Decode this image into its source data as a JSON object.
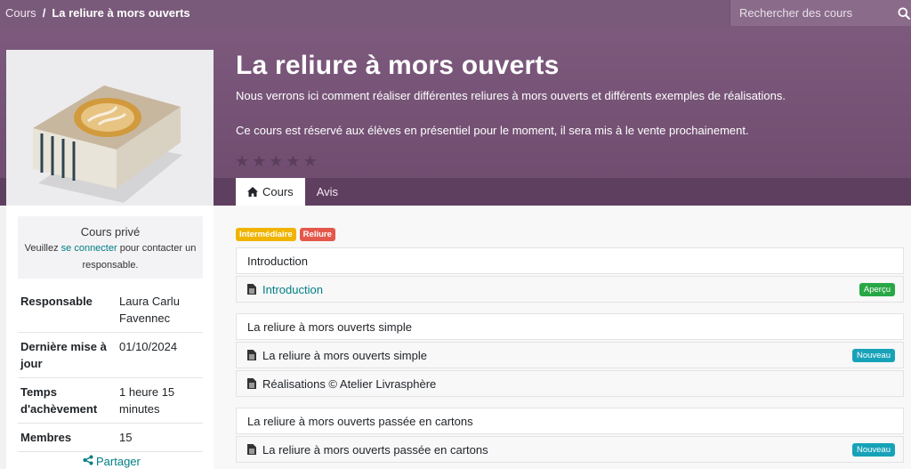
{
  "breadcrumb": {
    "root": "Cours",
    "separator": "/",
    "current": "La reliure à mors ouverts"
  },
  "search": {
    "placeholder": "Rechercher des cours"
  },
  "course": {
    "title": "La reliure à mors ouverts",
    "description": "Nous verrons ici comment réaliser différentes reliures à mors ouverts et différents exemples de réalisations.",
    "note": "Ce cours est réservé aux élèves en présentiel pour le moment, il sera mis à le vente prochainement.",
    "rating": 0
  },
  "tabs": [
    {
      "label": "Cours",
      "icon": "home-icon",
      "active": true
    },
    {
      "label": "Avis",
      "active": false
    }
  ],
  "private_box": {
    "title": "Cours privé",
    "text_before": "Veuillez ",
    "link": "se connecter",
    "text_after": " pour contacter un responsable."
  },
  "info": [
    {
      "key": "Responsable",
      "value": "Laura Carlu Favennec"
    },
    {
      "key": "Dernière mise à jour",
      "value": "01/10/2024"
    },
    {
      "key": "Temps d'achèvement",
      "value": "1 heure 15 minutes"
    },
    {
      "key": "Membres",
      "value": "15"
    }
  ],
  "share_label": "Partager",
  "tags": [
    {
      "label": "Intermédiaire",
      "color": "#f0b400"
    },
    {
      "label": "Reliure",
      "color": "#e4584b"
    }
  ],
  "sections": [
    {
      "title": "Introduction",
      "lessons": [
        {
          "label": "Introduction",
          "badge": "Aperçu",
          "badge_color": "#28a745",
          "link": true
        }
      ]
    },
    {
      "title": "La reliure à mors ouverts simple",
      "lessons": [
        {
          "label": "La reliure à mors ouverts simple",
          "badge": "Nouveau",
          "badge_color": "#17a2b8"
        },
        {
          "label": "Réalisations © Atelier Livrasphère",
          "badge": ""
        }
      ]
    },
    {
      "title": "La reliure à mors ouverts passée en cartons",
      "lessons": [
        {
          "label": "La reliure à mors ouverts passée en cartons",
          "badge": "Nouveau",
          "badge_color": "#17a2b8"
        }
      ]
    }
  ],
  "colors": {
    "header": "#7a5a7a",
    "accent_link": "#017e84"
  }
}
